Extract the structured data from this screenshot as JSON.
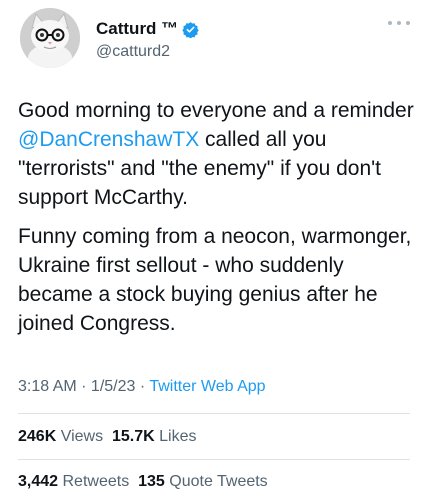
{
  "author": {
    "display_name": "Catturd ™",
    "handle": "@catturd2",
    "verified": true,
    "verified_color": "#1d9bf0"
  },
  "tweet": {
    "paragraph1": {
      "before": "Good morning to everyone and a reminder ",
      "mention": "@DanCrenshawTX",
      "after": " called all you \"terrorists\" and \"the enemy\" if you don't support McCarthy."
    },
    "paragraph2": "Funny coming from a neocon, warmonger, Ukraine first sellout - who suddenly became a stock buying genius after he joined Congress."
  },
  "meta": {
    "time": "3:18 AM",
    "separator": " · ",
    "date": "1/5/23",
    "source": "Twitter Web App"
  },
  "stats": {
    "views_count": "246K",
    "views_label": "Views",
    "likes_count": "15.7K",
    "likes_label": "Likes",
    "retweets_count": "3,442",
    "retweets_label": "Retweets",
    "quotes_count": "135",
    "quotes_label": "Quote Tweets"
  },
  "colors": {
    "link": "#1d9bf0",
    "secondary_text": "#536471",
    "primary_text": "#0f1419"
  },
  "icons": [
    "cat-avatar",
    "verified-badge-icon",
    "more-options-icon"
  ]
}
